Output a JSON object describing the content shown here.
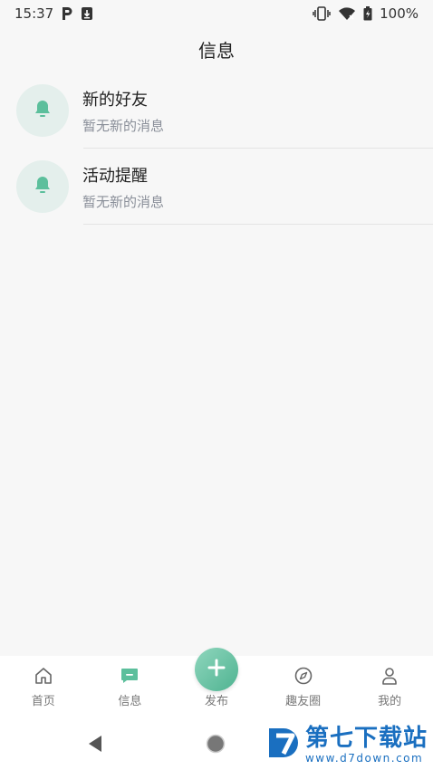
{
  "status_bar": {
    "time": "15:37",
    "battery": "100%",
    "icons": [
      "parking-icon",
      "download-icon",
      "vibrate-icon",
      "wifi-icon",
      "battery-icon"
    ]
  },
  "header": {
    "title": "信息"
  },
  "messages": [
    {
      "title": "新的好友",
      "subtitle": "暂无新的消息",
      "icon": "bell-icon"
    },
    {
      "title": "活动提醒",
      "subtitle": "暂无新的消息",
      "icon": "bell-icon"
    }
  ],
  "tab_bar": {
    "tabs": [
      {
        "label": "首页",
        "icon": "home-icon"
      },
      {
        "label": "信息",
        "icon": "message-icon"
      },
      {
        "label": "发布",
        "icon": "plus-icon"
      },
      {
        "label": "趣友圈",
        "icon": "compass-icon"
      },
      {
        "label": "我的",
        "icon": "user-icon"
      }
    ],
    "active_index": 1
  },
  "nav_bar": {
    "icons": [
      "back-icon",
      "home-circle-icon"
    ]
  },
  "watermark": {
    "title": "第七下载站",
    "url": "www.d7down.com"
  },
  "colors": {
    "accent": "#5cbf9c",
    "avatar_bg": "#e4efec",
    "subtitle": "#8a8f99",
    "watermark": "#1a6fc0"
  }
}
